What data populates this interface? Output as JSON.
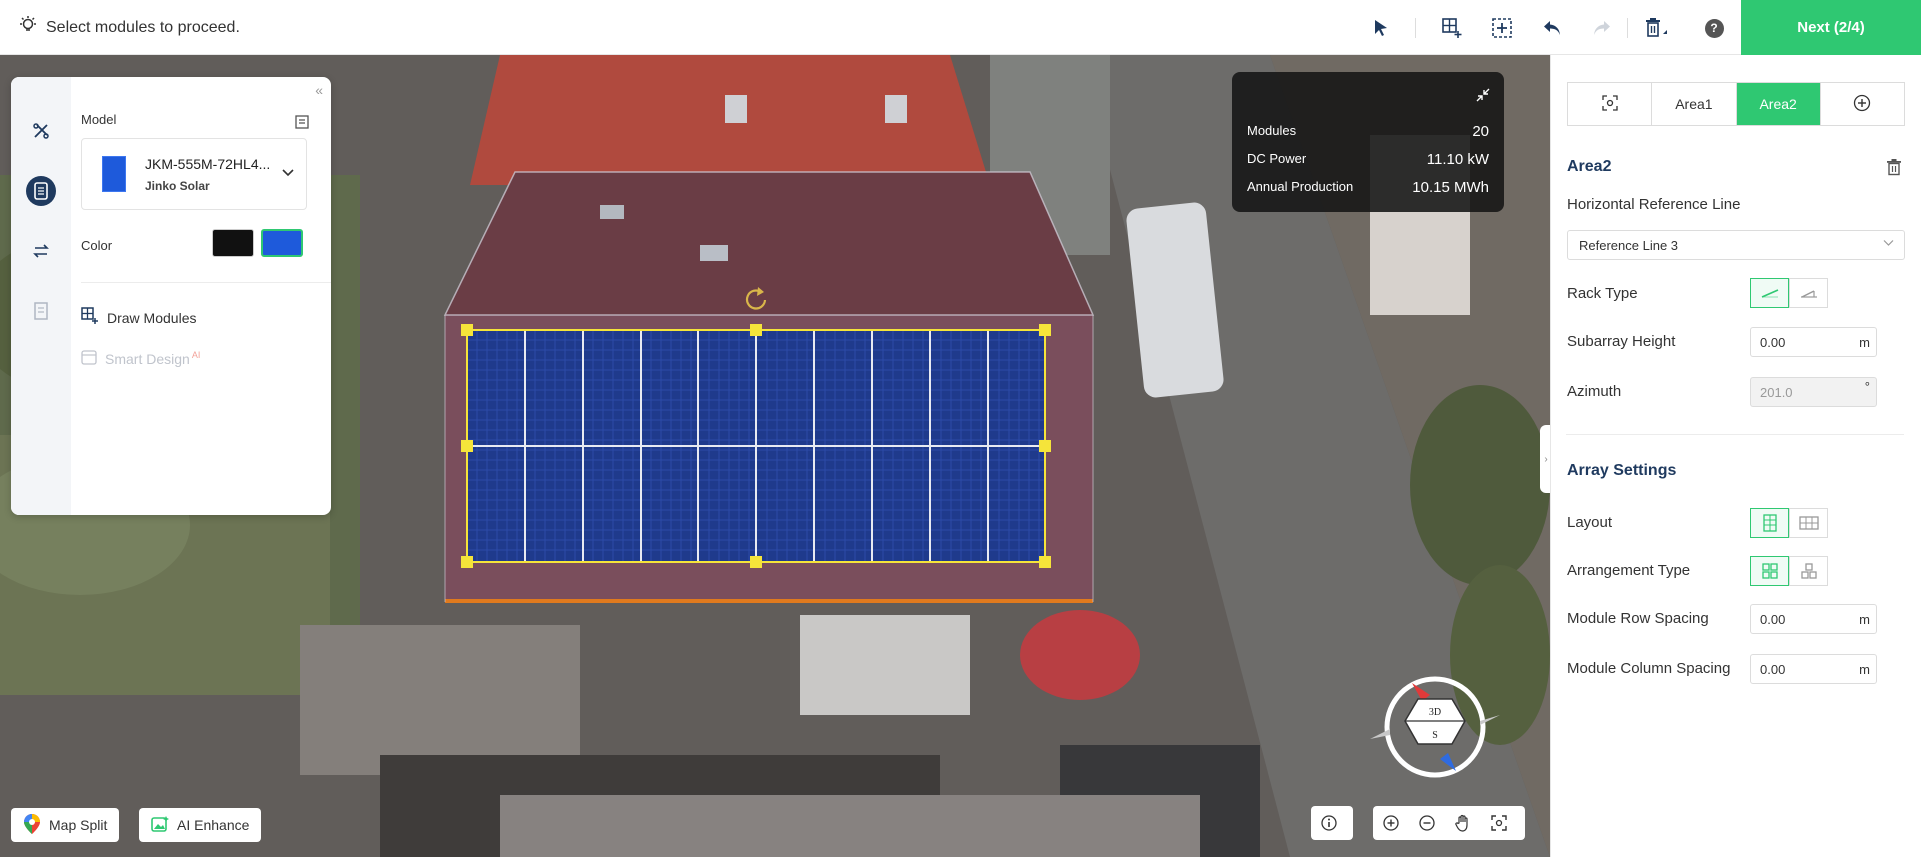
{
  "topbar": {
    "hint": "Select modules to proceed.",
    "next_label": "Next (2/4)",
    "help_label": "?"
  },
  "left_panel": {
    "model_label": "Model",
    "model_name": "JKM-555M-72HL4...",
    "model_brand": "Jinko Solar",
    "color_label": "Color",
    "color_options": [
      "#111111",
      "#1e5adb"
    ],
    "draw_modules_label": "Draw Modules",
    "smart_design_label": "Smart Design",
    "smart_design_badge": "AI"
  },
  "info": {
    "modules_label": "Modules",
    "modules_value": "20",
    "dc_power_label": "DC Power",
    "dc_power_value": "11.10 kW",
    "annual_label": "Annual Production",
    "annual_value": "10.15 MWh"
  },
  "compass": {
    "top": "3D",
    "bottom": "S"
  },
  "bottom": {
    "map_split_label": "Map Split",
    "ai_enhance_label": "AI Enhance"
  },
  "right_panel": {
    "tabs": [
      "Area1",
      "Area2"
    ],
    "area_title": "Area2",
    "horizontal_ref_label": "Horizontal Reference Line",
    "horizontal_ref_value": "Reference Line 3",
    "rack_type_label": "Rack Type",
    "subarray_height_label": "Subarray Height",
    "subarray_height_value": "0.00",
    "azimuth_label": "Azimuth",
    "azimuth_value": "201.0",
    "unit_m": "m",
    "unit_deg": "°",
    "array_settings_title": "Array Settings",
    "layout_label": "Layout",
    "arrangement_label": "Arrangement Type",
    "row_spacing_label": "Module Row Spacing",
    "row_spacing_value": "0.00",
    "col_spacing_label": "Module Column Spacing",
    "col_spacing_value": "0.00"
  },
  "colors": {
    "accent": "#2fc872",
    "navy": "#1f3a5f",
    "module_blue": "#1e3f9a",
    "selection": "#f5e43a"
  }
}
